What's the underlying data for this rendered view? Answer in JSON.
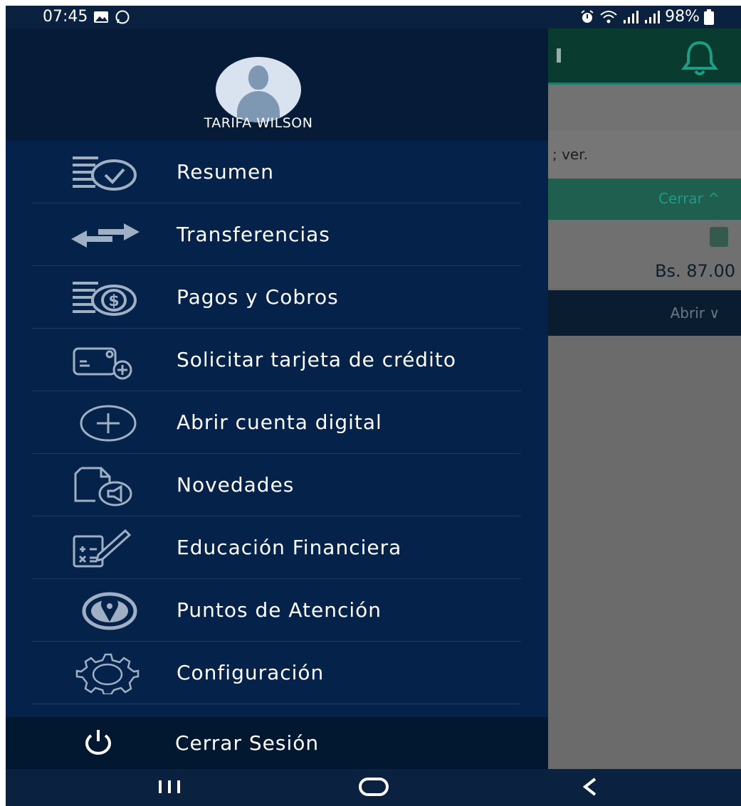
{
  "status_bar": {
    "time": "07:45",
    "battery": "98%",
    "icons": [
      "gallery-icon",
      "whatsapp-icon",
      "alarm-icon",
      "wifi-icon",
      "signal-icon",
      "signal-icon",
      "battery-icon"
    ]
  },
  "background_app": {
    "partial_text": "; ver.",
    "close_label": "Cerrar ^",
    "amount": "Bs. 87.00",
    "open_label": "Abrir ∨",
    "accent_color": "#1b7b68"
  },
  "drawer": {
    "user_name": "TARIFA WILSON",
    "menu": [
      {
        "label": "Resumen",
        "icon": "summary-check-icon"
      },
      {
        "label": "Transferencias",
        "icon": "transfer-arrows-icon"
      },
      {
        "label": "Pagos y Cobros",
        "icon": "payments-dollar-icon"
      },
      {
        "label": "Solicitar tarjeta de crédito",
        "icon": "credit-card-add-icon"
      },
      {
        "label": "Abrir cuenta digital",
        "icon": "plus-circle-icon"
      },
      {
        "label": "Novedades",
        "icon": "news-megaphone-icon"
      },
      {
        "label": "Educación Financiera",
        "icon": "calculator-pen-icon"
      },
      {
        "label": "Puntos de Atención",
        "icon": "location-pin-icon"
      },
      {
        "label": "Configuración",
        "icon": "gear-icon"
      }
    ],
    "logout_label": "Cerrar Sesión",
    "colors": {
      "drawer_bg": "#05234a",
      "header_bg": "#051b37",
      "icon": "#9fb0c4"
    }
  },
  "nav_bar": {
    "buttons": [
      "recents-button",
      "home-button",
      "back-button"
    ]
  }
}
